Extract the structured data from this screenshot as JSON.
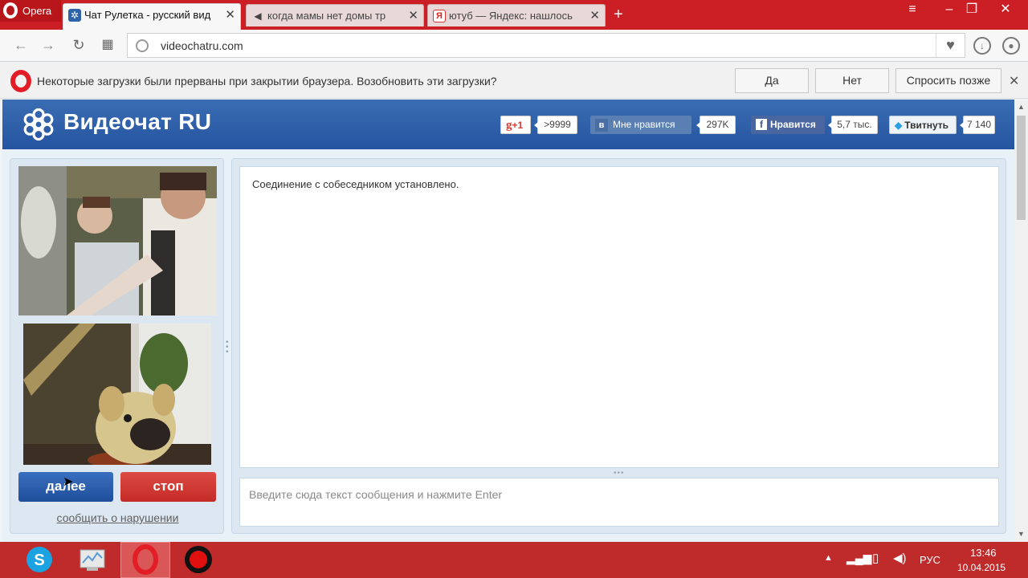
{
  "browser": {
    "app_label": "Opera",
    "tabs": [
      {
        "title": "Чат Рулетка - русский вид",
        "icon": "videochat-icon",
        "active": true
      },
      {
        "title": "когда мамы нет домы тр",
        "icon": "sound-icon",
        "active": false
      },
      {
        "title": "ютуб — Яндекс: нашлось",
        "icon": "yandex-icon",
        "active": false
      }
    ],
    "new_tab": "+",
    "address": "videochatru.com"
  },
  "infobar": {
    "message": "Некоторые загрузки были прерваны при закрытии браузера. Возобновить эти загрузки?",
    "yes": "Да",
    "no": "Нет",
    "later": "Спросить позже"
  },
  "site": {
    "logo": "Видеочат RU",
    "social": {
      "gplus_label": "+1",
      "gplus_count": ">9999",
      "vk_label": "Мне нравится",
      "vk_count": "297K",
      "fb_label": "Нравится",
      "fb_count": "5,7 тыс.",
      "tw_label": "Твитнуть",
      "tw_count": "7 140"
    },
    "buttons": {
      "next": "далее",
      "stop": "стоп"
    },
    "report_link": "сообщить о нарушении",
    "chat": {
      "messages": [
        "Соединение с собеседником установлено."
      ],
      "input_placeholder": "Введите сюда текст сообщения и нажмите Enter"
    }
  },
  "taskbar": {
    "lang": "РУС",
    "time": "13:46",
    "date": "10.04.2015",
    "apps": [
      "skype-icon",
      "monitor-icon",
      "opera-icon",
      "record-icon"
    ]
  },
  "colors": {
    "opera_red": "#cc1f25",
    "site_blue": "#2f5fa8",
    "stop_red": "#d03a35",
    "taskbar_red": "#bf2a2b"
  }
}
